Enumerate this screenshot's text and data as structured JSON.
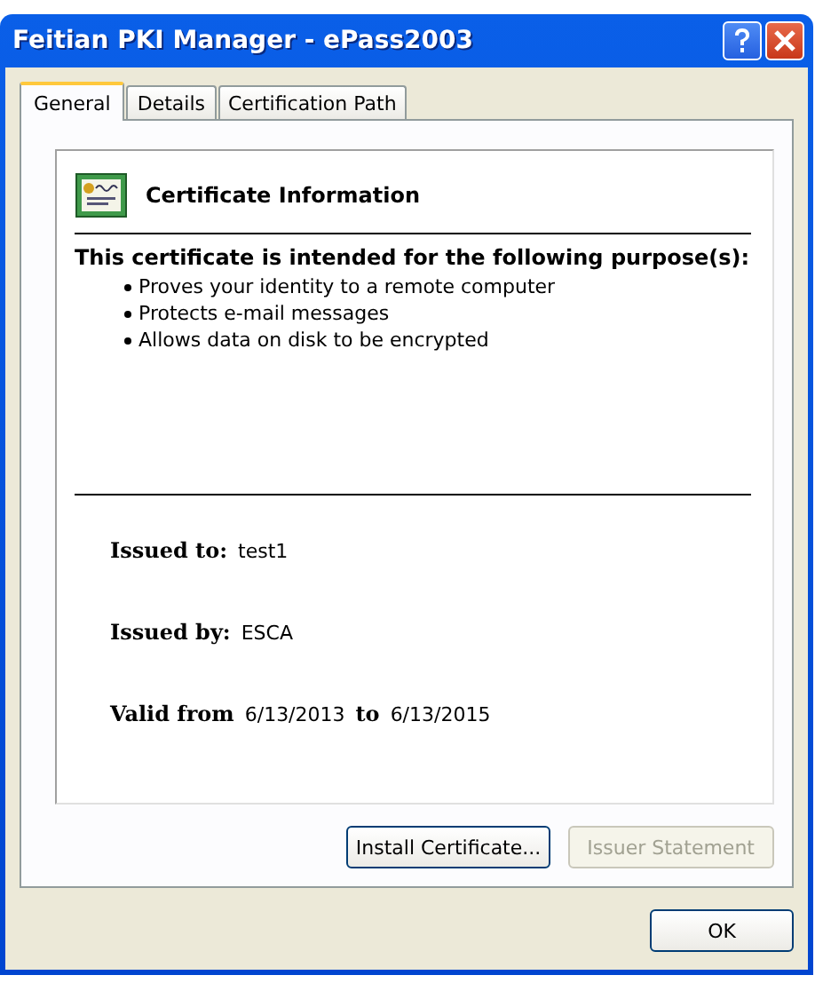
{
  "window": {
    "title": "Feitian PKI Manager - ePass2003"
  },
  "tabs": [
    {
      "label": "General",
      "selected": true
    },
    {
      "label": "Details",
      "selected": false
    },
    {
      "label": "Certification Path",
      "selected": false
    }
  ],
  "certificate": {
    "heading": "Certificate Information",
    "purpose_title": "This certificate is intended for the following purpose(s):",
    "purposes": [
      "Proves your identity to a remote computer",
      "Protects e-mail messages",
      "Allows data on disk to be encrypted"
    ],
    "issued_to_label": "Issued to:",
    "issued_to": "test1",
    "issued_by_label": "Issued by:",
    "issued_by": "ESCA",
    "valid_from_label": "Valid from",
    "valid_from": "6/13/2013",
    "valid_to_label": "to",
    "valid_to": "6/13/2015"
  },
  "buttons": [
    {
      "label": "Install Certificate...",
      "disabled": false
    },
    {
      "label": "Issuer Statement",
      "disabled": true
    }
  ],
  "ok_button": "OK"
}
